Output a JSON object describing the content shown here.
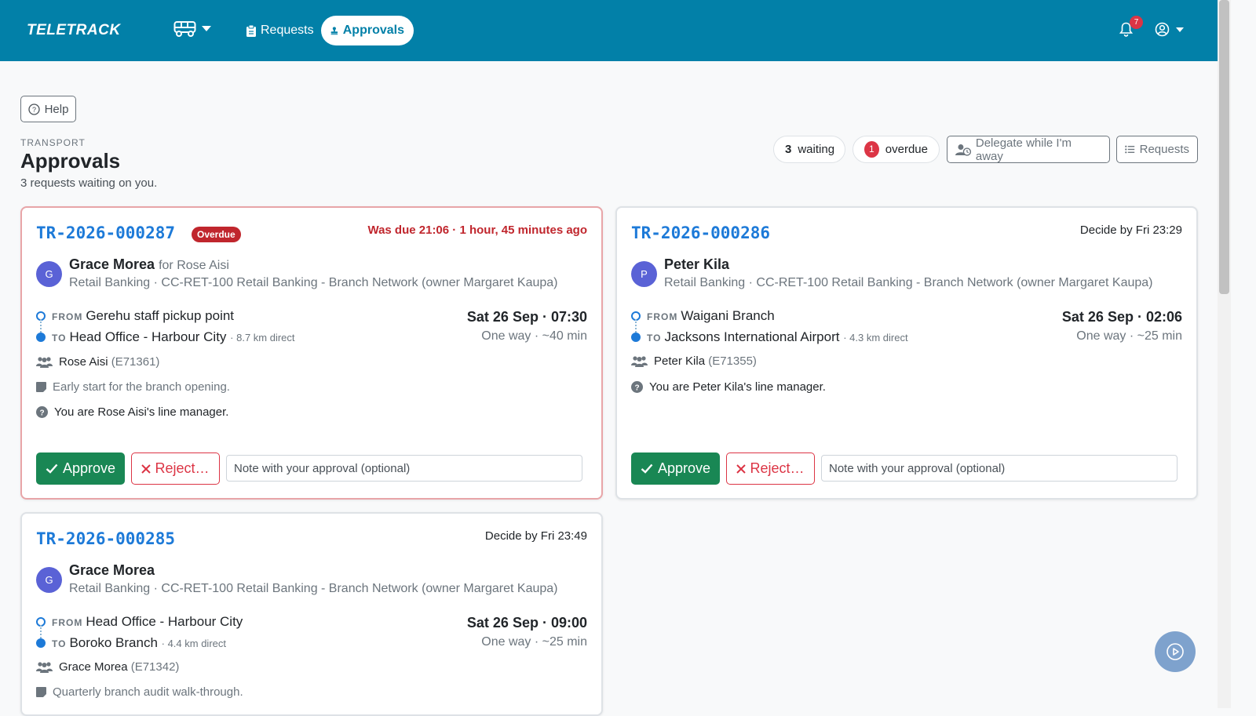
{
  "brand": "TELETRACK",
  "nav": {
    "requests_label": "Requests",
    "approvals_label": "Approvals",
    "notifications_count": "7"
  },
  "help_label": "Help",
  "header": {
    "eyebrow": "TRANSPORT",
    "title": "Approvals",
    "subtitle": "3 requests waiting on you.",
    "waiting_count": "3",
    "waiting_label": "waiting",
    "overdue_count": "1",
    "overdue_label": "overdue",
    "delegate_label": "Delegate while I'm away",
    "requests_label": "Requests"
  },
  "cards": [
    {
      "id": "TR-2026-000287",
      "badge": "Overdue",
      "deadline": "Was due 21:06 · 1 hour, 45 minutes ago",
      "avatar": "G",
      "requester": "Grace Morea",
      "for_text": "for Rose Aisi",
      "org": "Retail Banking · CC-RET-100 Retail Banking - Branch Network (owner Margaret Kaupa)",
      "from_label": "FROM",
      "from": "Gerehu staff pickup point",
      "to_label": "TO",
      "to": "Head Office - Harbour City",
      "distance": "· 8.7 km direct",
      "when": "Sat 26 Sep · 07:30",
      "trip": "One way · ~40 min",
      "passenger": "Rose Aisi",
      "passenger_id": "(E71361)",
      "note": "Early start for the branch opening.",
      "reason": "You are Rose Aisi's line manager.",
      "approve_label": "Approve",
      "reject_label": "Reject…",
      "note_placeholder": "Note with your approval (optional)"
    },
    {
      "id": "TR-2026-000286",
      "deadline": "Decide by Fri 23:29",
      "avatar": "P",
      "requester": "Peter Kila",
      "org": "Retail Banking · CC-RET-100 Retail Banking - Branch Network (owner Margaret Kaupa)",
      "from_label": "FROM",
      "from": "Waigani Branch",
      "to_label": "TO",
      "to": "Jacksons International Airport",
      "distance": "· 4.3 km direct",
      "when": "Sat 26 Sep · 02:06",
      "trip": "One way · ~25 min",
      "passenger": "Peter Kila",
      "passenger_id": "(E71355)",
      "reason": "You are Peter Kila's line manager.",
      "approve_label": "Approve",
      "reject_label": "Reject…",
      "note_placeholder": "Note with your approval (optional)"
    },
    {
      "id": "TR-2026-000285",
      "deadline": "Decide by Fri 23:49",
      "avatar": "G",
      "requester": "Grace Morea",
      "org": "Retail Banking · CC-RET-100 Retail Banking - Branch Network (owner Margaret Kaupa)",
      "from_label": "FROM",
      "from": "Head Office - Harbour City",
      "to_label": "TO",
      "to": "Boroko Branch",
      "distance": "· 4.4 km direct",
      "when": "Sat 26 Sep · 09:00",
      "trip": "One way · ~25 min",
      "passenger": "Grace Morea",
      "passenger_id": "(E71342)",
      "note": "Quarterly branch audit walk-through."
    }
  ],
  "colors": {
    "topbar": "#0280a8",
    "approve": "#198754",
    "danger": "#dc3545",
    "link": "#1d7ad8"
  }
}
